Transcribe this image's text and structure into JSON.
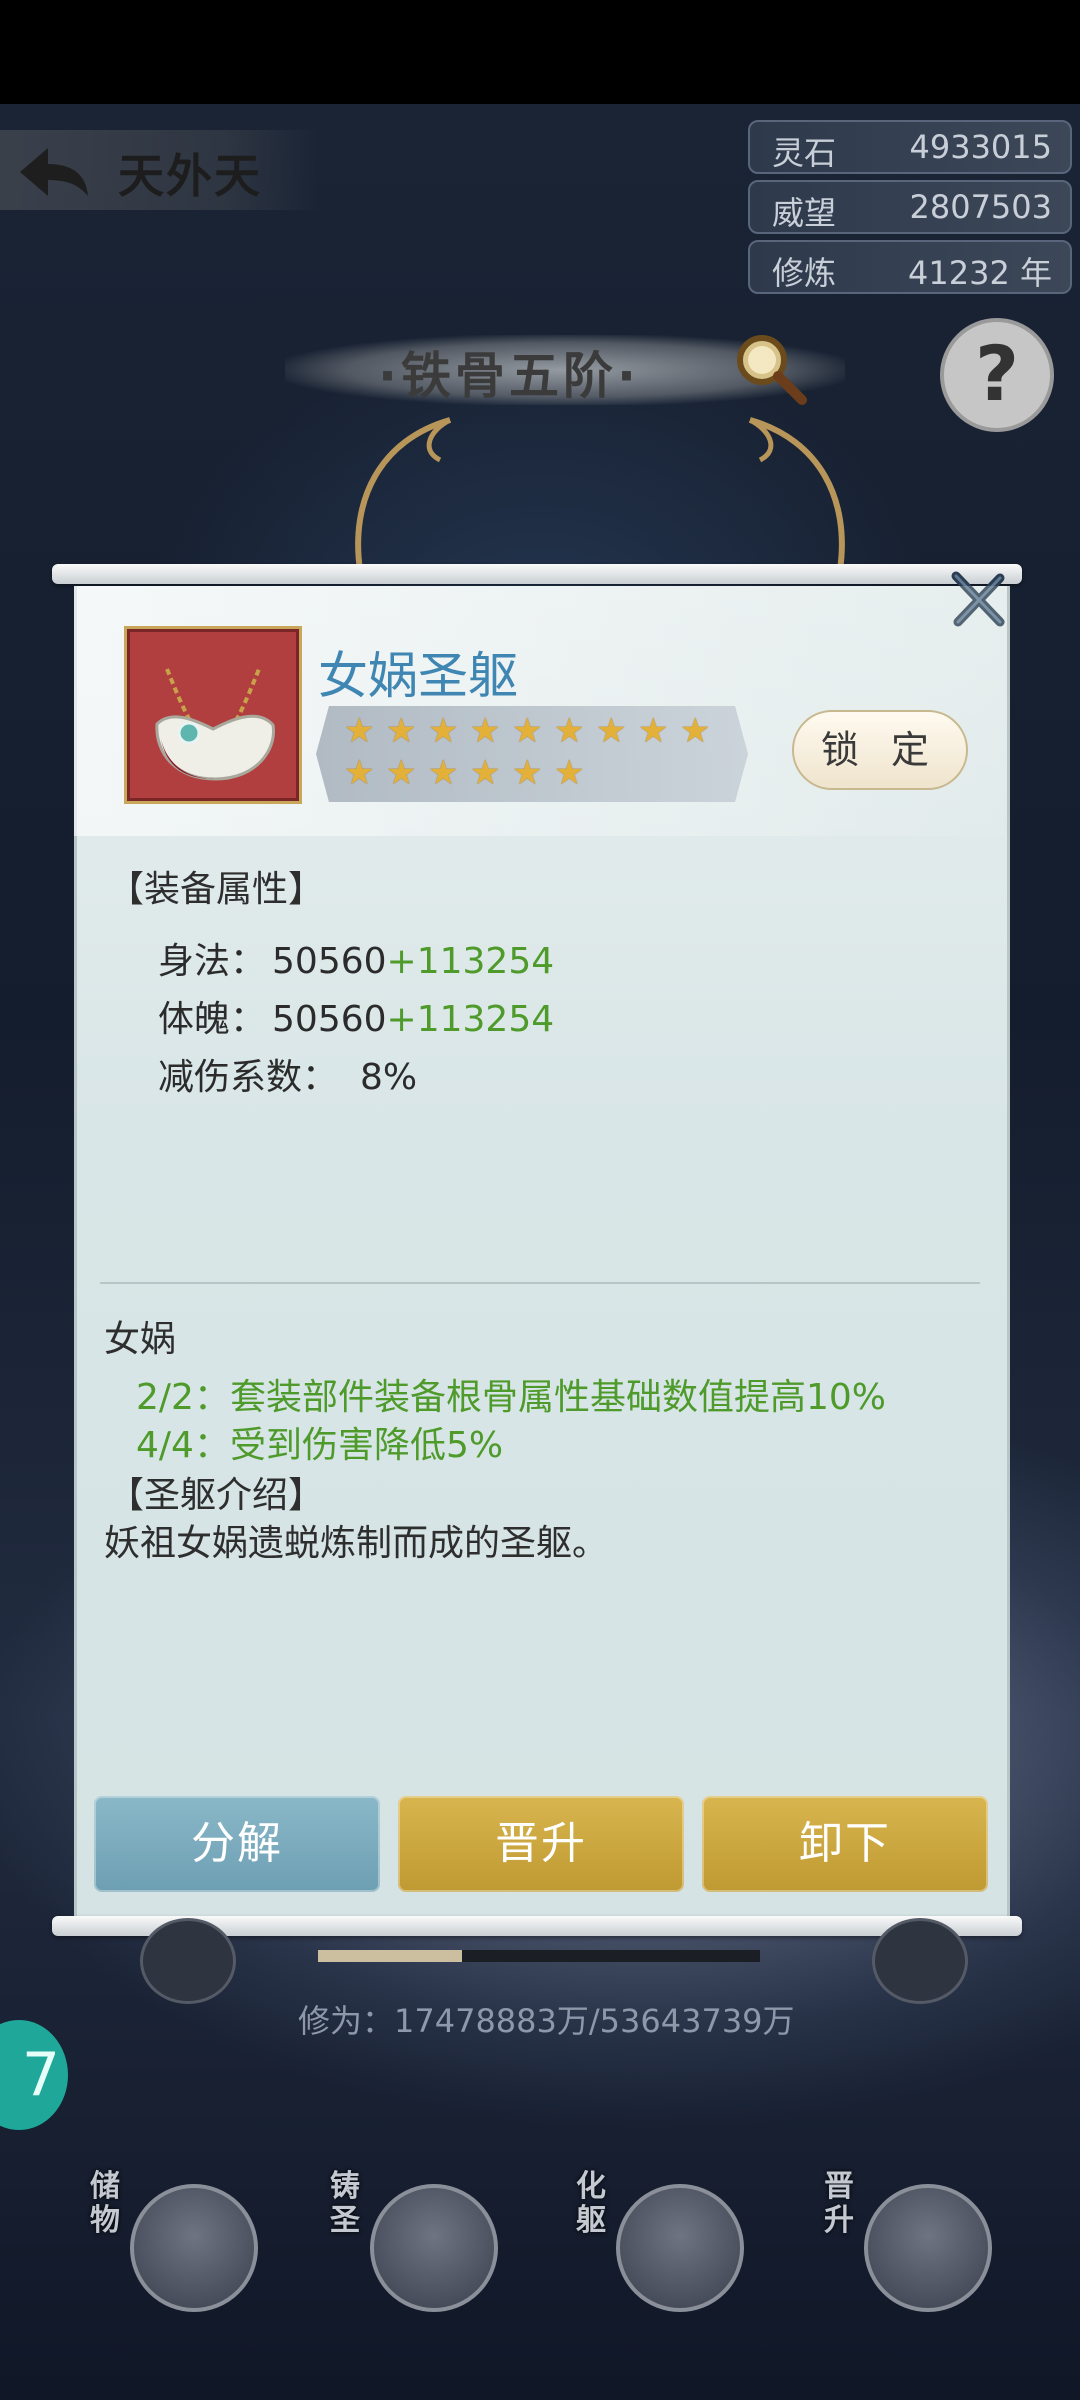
{
  "header": {
    "back_title": "天外天",
    "resources": [
      {
        "label": "灵石",
        "value": "4933015"
      },
      {
        "label": "威望",
        "value": "2807503"
      },
      {
        "label": "修炼",
        "value": "41232 年"
      }
    ],
    "realm_title": "·铁骨五阶·",
    "help_label": "?"
  },
  "item": {
    "name": "女娲圣躯",
    "stars": 15,
    "lock_label": "锁 定",
    "attr_section_title": "【装备属性】",
    "attributes": [
      {
        "label": "身法：",
        "base": "50560",
        "bonus": "+113254"
      },
      {
        "label": "体魄：",
        "base": "50560",
        "bonus": "+113254"
      },
      {
        "label": "减伤系数：",
        "base": "8%",
        "bonus": ""
      }
    ],
    "set_name": "女娲",
    "set_bonuses": [
      "2/2：套装部件装备根骨属性基础数值提高10%",
      "4/4：受到伤害降低5%"
    ],
    "intro_title": "【圣躯介绍】",
    "intro_text": "妖祖女娲遗蜕炼制而成的圣躯。"
  },
  "actions": {
    "decompose": "分解",
    "promote": "晋升",
    "unequip": "卸下"
  },
  "bottom": {
    "cultivation_text": "修为：17478883万/53643739万",
    "cultivation_progress": 0.326,
    "side_badge": "7",
    "nav": [
      {
        "label": "储物",
        "icon": "bag-icon"
      },
      {
        "label": "铸圣",
        "icon": "forge-icon"
      },
      {
        "label": "化躯",
        "icon": "body-icon"
      },
      {
        "label": "晋升",
        "icon": "ascend-icon"
      }
    ]
  },
  "colors": {
    "item_name": "#3f86b3",
    "bonus_green": "#4e9a2a",
    "star_gold": "#e3b03a",
    "btn_blue": "#7aaabd",
    "btn_gold": "#cba640"
  }
}
